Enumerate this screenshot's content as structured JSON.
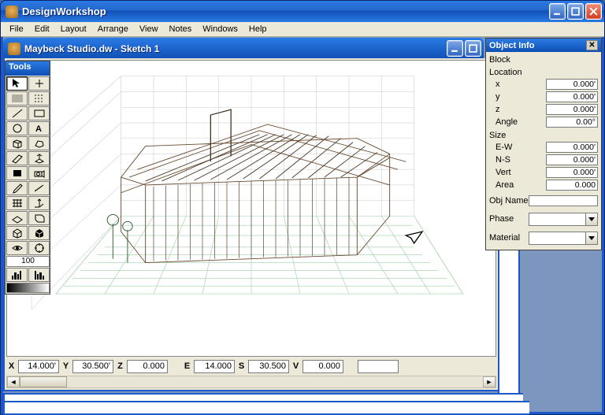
{
  "app": {
    "title": "DesignWorkshop"
  },
  "menu": {
    "items": [
      "File",
      "Edit",
      "Layout",
      "Arrange",
      "View",
      "Notes",
      "Windows",
      "Help"
    ]
  },
  "document": {
    "title": "Maybeck Studio.dw - Sketch 1"
  },
  "tools": {
    "title": "Tools",
    "readout": "100"
  },
  "coords": {
    "X": "14.000'",
    "Y": "30.500'",
    "Z": "0.000",
    "E": "14.000",
    "S": "30.500",
    "V": "0.000",
    "extra": ""
  },
  "object_info": {
    "title": "Object Info",
    "type": "Block",
    "section_location": "Location",
    "x_label": "x",
    "x": "0.000'",
    "y_label": "y",
    "y": "0.000'",
    "z_label": "z",
    "z": "0.000'",
    "angle_label": "Angle",
    "angle": "0.00°",
    "section_size": "Size",
    "ew_label": "E-W",
    "ew": "0.000'",
    "ns_label": "N-S",
    "ns": "0.000'",
    "vert_label": "Vert",
    "vert": "0.000'",
    "area_label": "Area",
    "area": "0.000",
    "objname_label": "Obj Name",
    "objname": "",
    "phase_label": "Phase",
    "phase": "",
    "material_label": "Material",
    "material": ""
  }
}
